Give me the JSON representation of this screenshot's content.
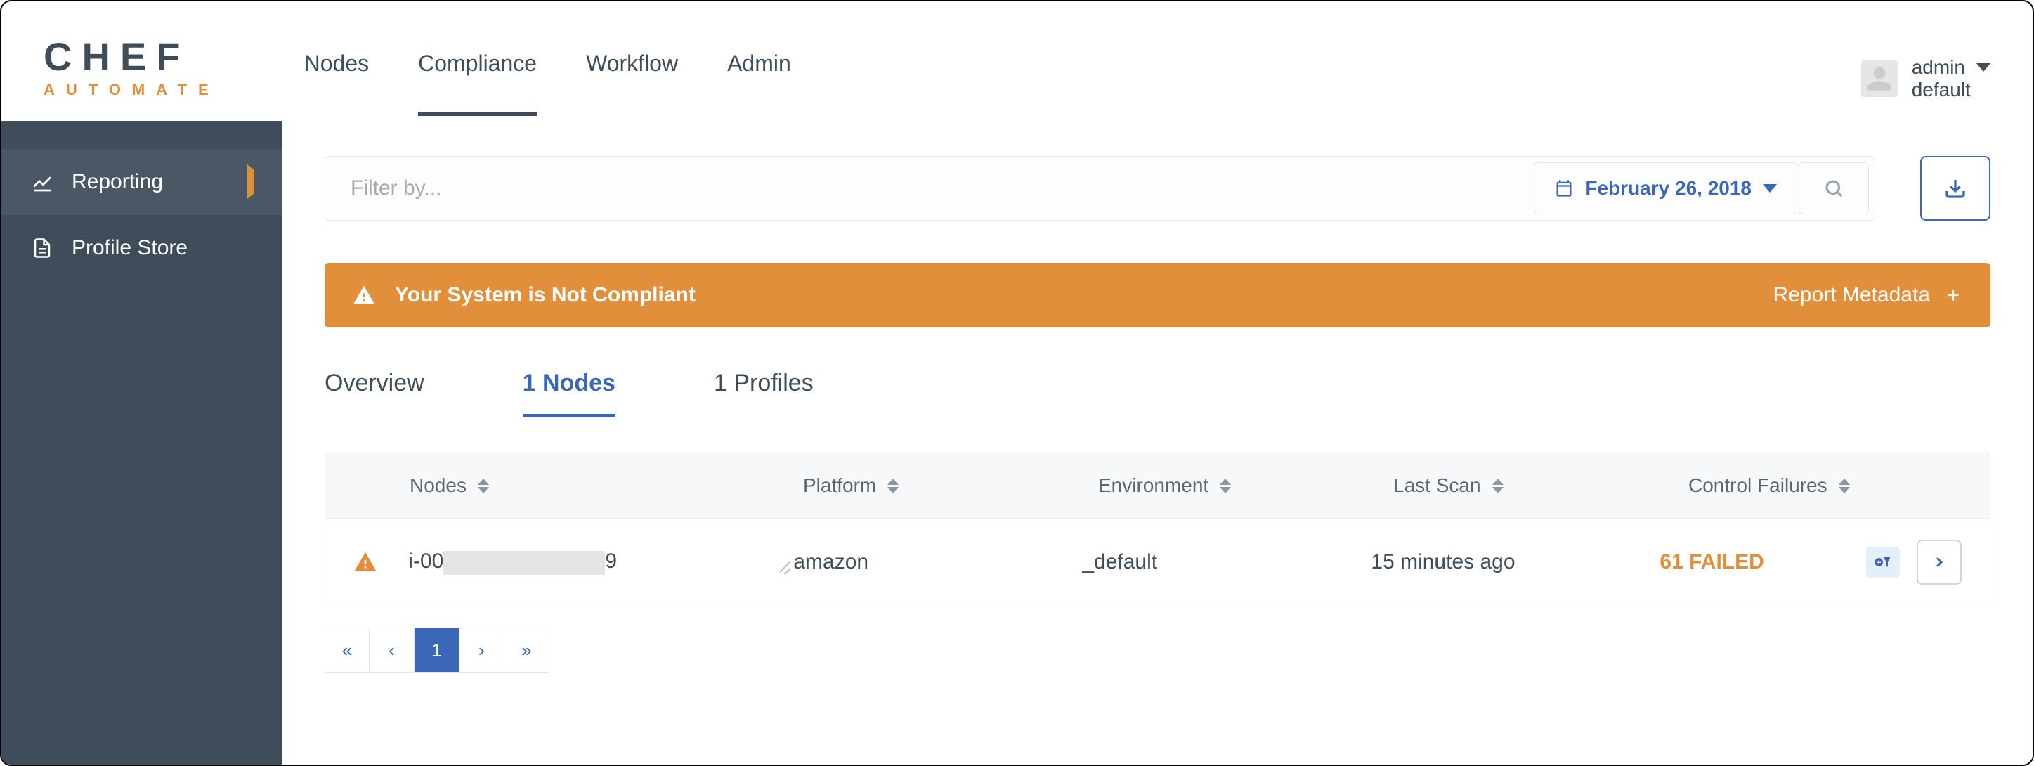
{
  "brand": {
    "name": "CHEF",
    "sub": "AUTOMATE"
  },
  "nav": {
    "items": [
      {
        "label": "Nodes"
      },
      {
        "label": "Compliance"
      },
      {
        "label": "Workflow"
      },
      {
        "label": "Admin"
      }
    ],
    "active": 1
  },
  "user": {
    "name": "admin",
    "tenant": "default"
  },
  "sidebar": {
    "items": [
      {
        "label": "Reporting",
        "icon": "chart-icon",
        "active": true,
        "expandable": true
      },
      {
        "label": "Profile Store",
        "icon": "document-icon",
        "active": false,
        "expandable": false
      }
    ]
  },
  "filter": {
    "placeholder": "Filter by...",
    "date": "February 26, 2018"
  },
  "banner": {
    "text": "Your System is Not Compliant",
    "meta_label": "Report Metadata"
  },
  "tabs": {
    "items": [
      {
        "label": "Overview"
      },
      {
        "label": "1 Nodes"
      },
      {
        "label": "1 Profiles"
      }
    ],
    "active": 1
  },
  "table": {
    "columns": [
      {
        "label": "Nodes"
      },
      {
        "label": "Platform"
      },
      {
        "label": "Environment"
      },
      {
        "label": "Last Scan"
      },
      {
        "label": "Control Failures"
      }
    ],
    "rows": [
      {
        "status": "warning",
        "node_prefix": "i-00",
        "node_suffix": "9",
        "node_redacted": true,
        "platform": "amazon",
        "environment": "_default",
        "last_scan": "15 minutes ago",
        "failures": "61 FAILED"
      }
    ]
  },
  "pager": {
    "pages": [
      "1"
    ],
    "active": 0
  },
  "colors": {
    "accent": "#e28f3c",
    "primary": "#3a67b7",
    "dark": "#3f4d5a"
  }
}
